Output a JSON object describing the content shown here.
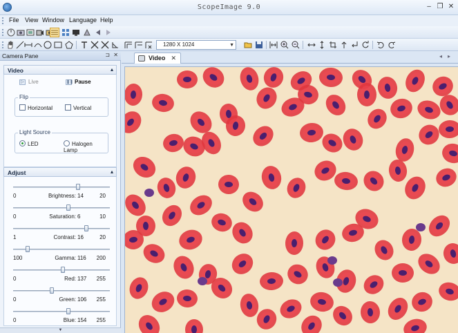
{
  "window": {
    "title": "ScopeImage 9.0",
    "min_icon": "minimize-icon",
    "restore_icon": "restore-icon",
    "close_icon": "close-icon"
  },
  "menu": [
    "File",
    "View",
    "Window",
    "Language",
    "Help"
  ],
  "toolbar": {
    "resolution": "1280 X 1024",
    "icons_row1": [
      "power-icon",
      "camera-icon",
      "capture-icon",
      "record-icon",
      "grid-icon",
      "tile-icon",
      "display-icon",
      "mirror-icon",
      "play-prev-icon",
      "play-next-icon"
    ],
    "icons_row2_left": [
      "hand-icon",
      "line-icon",
      "hline-icon",
      "circle-icon",
      "rect-icon",
      "polygon-icon",
      "text-icon",
      "cross-icon",
      "x-icon",
      "angle-icon",
      "measure-icon",
      "measure2-icon",
      "measure3-icon"
    ],
    "icons_row2_right": [
      "open-folder-icon",
      "save-icon",
      "fit-icon",
      "zoom-in-icon",
      "zoom-out-icon",
      "flip-h-icon",
      "flip-v-icon",
      "crop-icon",
      "arrow-up-icon",
      "arrow-turn-icon",
      "rotate-icon",
      "undo-icon",
      "redo-icon"
    ]
  },
  "pane": {
    "title": "Camera Pane",
    "pin": "⊐",
    "close": "✕",
    "video_section": {
      "title": "Video",
      "live": "Live",
      "pause": "Pause",
      "flip": {
        "title": "Flip",
        "horizontal": "Horizontal",
        "vertical": "Vertical"
      },
      "light": {
        "title": "Light Source",
        "led": "LED",
        "halogen": "Halogen Lamp",
        "selected": "LED"
      }
    },
    "adjust_section": {
      "title": "Adjust",
      "sliders": [
        {
          "label": "Brightness:",
          "value": "14",
          "min": "0",
          "max": "20",
          "fraction": 0.7
        },
        {
          "label": "Saturation:",
          "value": "6",
          "min": "0",
          "max": "10",
          "fraction": 0.6
        },
        {
          "label": "Contrast:",
          "value": "16",
          "min": "1",
          "max": "20",
          "fraction": 0.79
        },
        {
          "label": "Gamma:",
          "value": "116",
          "min": "100",
          "max": "200",
          "fraction": 0.16
        },
        {
          "label": "Red:",
          "value": "137",
          "min": "0",
          "max": "255",
          "fraction": 0.54
        },
        {
          "label": "Green:",
          "value": "106",
          "min": "0",
          "max": "255",
          "fraction": 0.42
        },
        {
          "label": "Blue:",
          "value": "154",
          "min": "0",
          "max": "255",
          "fraction": 0.6
        }
      ]
    }
  },
  "tabs": [
    {
      "label": "Video",
      "close": "✕"
    }
  ],
  "viewport": {
    "background": "#f5e4c6",
    "cell_color": "#e0353f",
    "nucleus_color": "#4a1f6e"
  }
}
